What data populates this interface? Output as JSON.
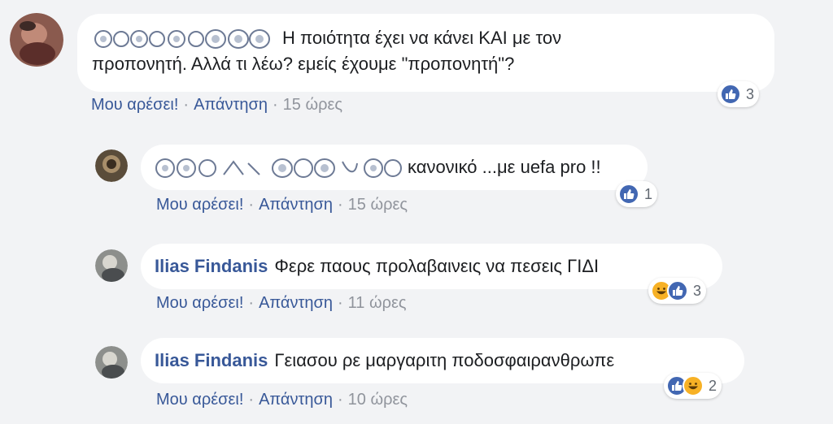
{
  "comments": [
    {
      "author": "",
      "text_line1": "Η ποιότητα έχει να κάνει ΚΑΙ με τον",
      "text_line2": "προπονητή. Αλλά τι λέω? εμείς έχουμε \"προπονητή\"?",
      "like_label": "Μου αρέσει!",
      "reply_label": "Απάντηση",
      "time": "15 ώρες",
      "reactions": [
        "like-icon"
      ],
      "reaction_count": "3"
    },
    {
      "author": "",
      "text": "κανονικό ...με uefa pro !!",
      "like_label": "Μου αρέσει!",
      "reply_label": "Απάντηση",
      "time": "15 ώρες",
      "reactions": [
        "like-icon"
      ],
      "reaction_count": "1"
    },
    {
      "author": "Ilias Findanis",
      "text": "Φερε παους προλαβαινεις να πεσεις ΓΙΔΙ",
      "like_label": "Μου αρέσει!",
      "reply_label": "Απάντηση",
      "time": "11 ώρες",
      "reactions": [
        "haha-icon",
        "like-icon"
      ],
      "reaction_count": "3"
    },
    {
      "author": "Ilias Findanis",
      "text": "Γειασου ρε μαργαριτη ποδοσφαιρανθρωπε",
      "like_label": "Μου αρέσει!",
      "reply_label": "Απάντηση",
      "time": "10 ώρες",
      "reactions": [
        "like-icon",
        "haha-icon"
      ],
      "reaction_count": "2"
    }
  ],
  "separator": "·",
  "colors": {
    "background": "#f2f3f5",
    "bubble": "#ffffff",
    "author": "#385898",
    "link": "#385898",
    "meta": "#90949c",
    "like": "#4267b2",
    "haha": "#f7b125"
  }
}
